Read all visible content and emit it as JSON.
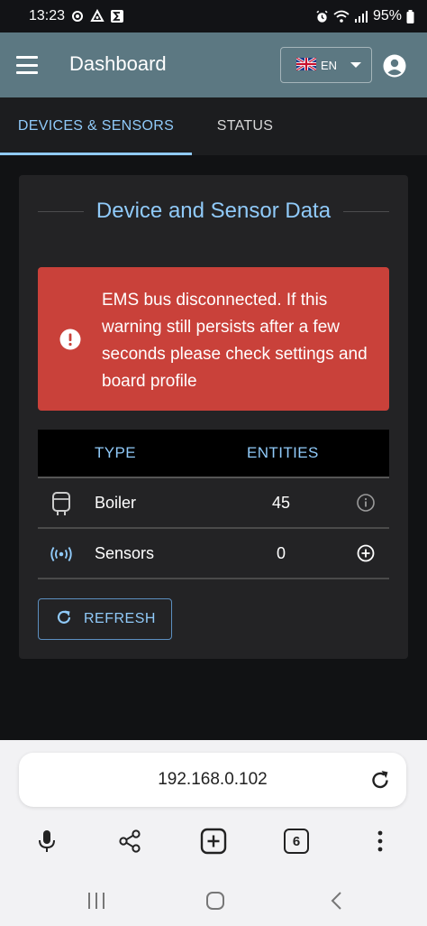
{
  "status_bar": {
    "time": "13:23",
    "battery": "95%"
  },
  "app_bar": {
    "title": "Dashboard",
    "language": "EN",
    "icons": [
      "menu-icon",
      "uk-flag-icon",
      "dropdown-caret-icon",
      "account-circle-icon"
    ]
  },
  "tabs": [
    {
      "label": "DEVICES & SENSORS",
      "active": true
    },
    {
      "label": "STATUS",
      "active": false
    }
  ],
  "card": {
    "title": "Device and Sensor Data",
    "alert": {
      "message": "EMS bus disconnected. If this warning still persists after a few seconds please check settings and board profile",
      "icon": "error-icon"
    },
    "table": {
      "headers": [
        "TYPE",
        "ENTITIES"
      ],
      "rows": [
        {
          "icon": "boiler-icon",
          "name": "Boiler",
          "entities": "45",
          "action_icon": "info-icon"
        },
        {
          "icon": "sensors-icon",
          "name": "Sensors",
          "entities": "0",
          "action_icon": "add-circle-icon"
        }
      ]
    },
    "refresh_label": "REFRESH"
  },
  "browser": {
    "url": "192.168.0.102",
    "tab_count": "6",
    "tools": [
      "microphone-icon",
      "share-icon",
      "new-tab-icon",
      "tab-count-icon",
      "more-vert-icon"
    ],
    "nav": [
      "recents-icon",
      "home-icon",
      "back-icon"
    ]
  },
  "colors": {
    "app_bar": "#5c7882",
    "accent": "#90caf9",
    "alert": "#c9413a",
    "card": "#232325",
    "background": "#111214"
  }
}
